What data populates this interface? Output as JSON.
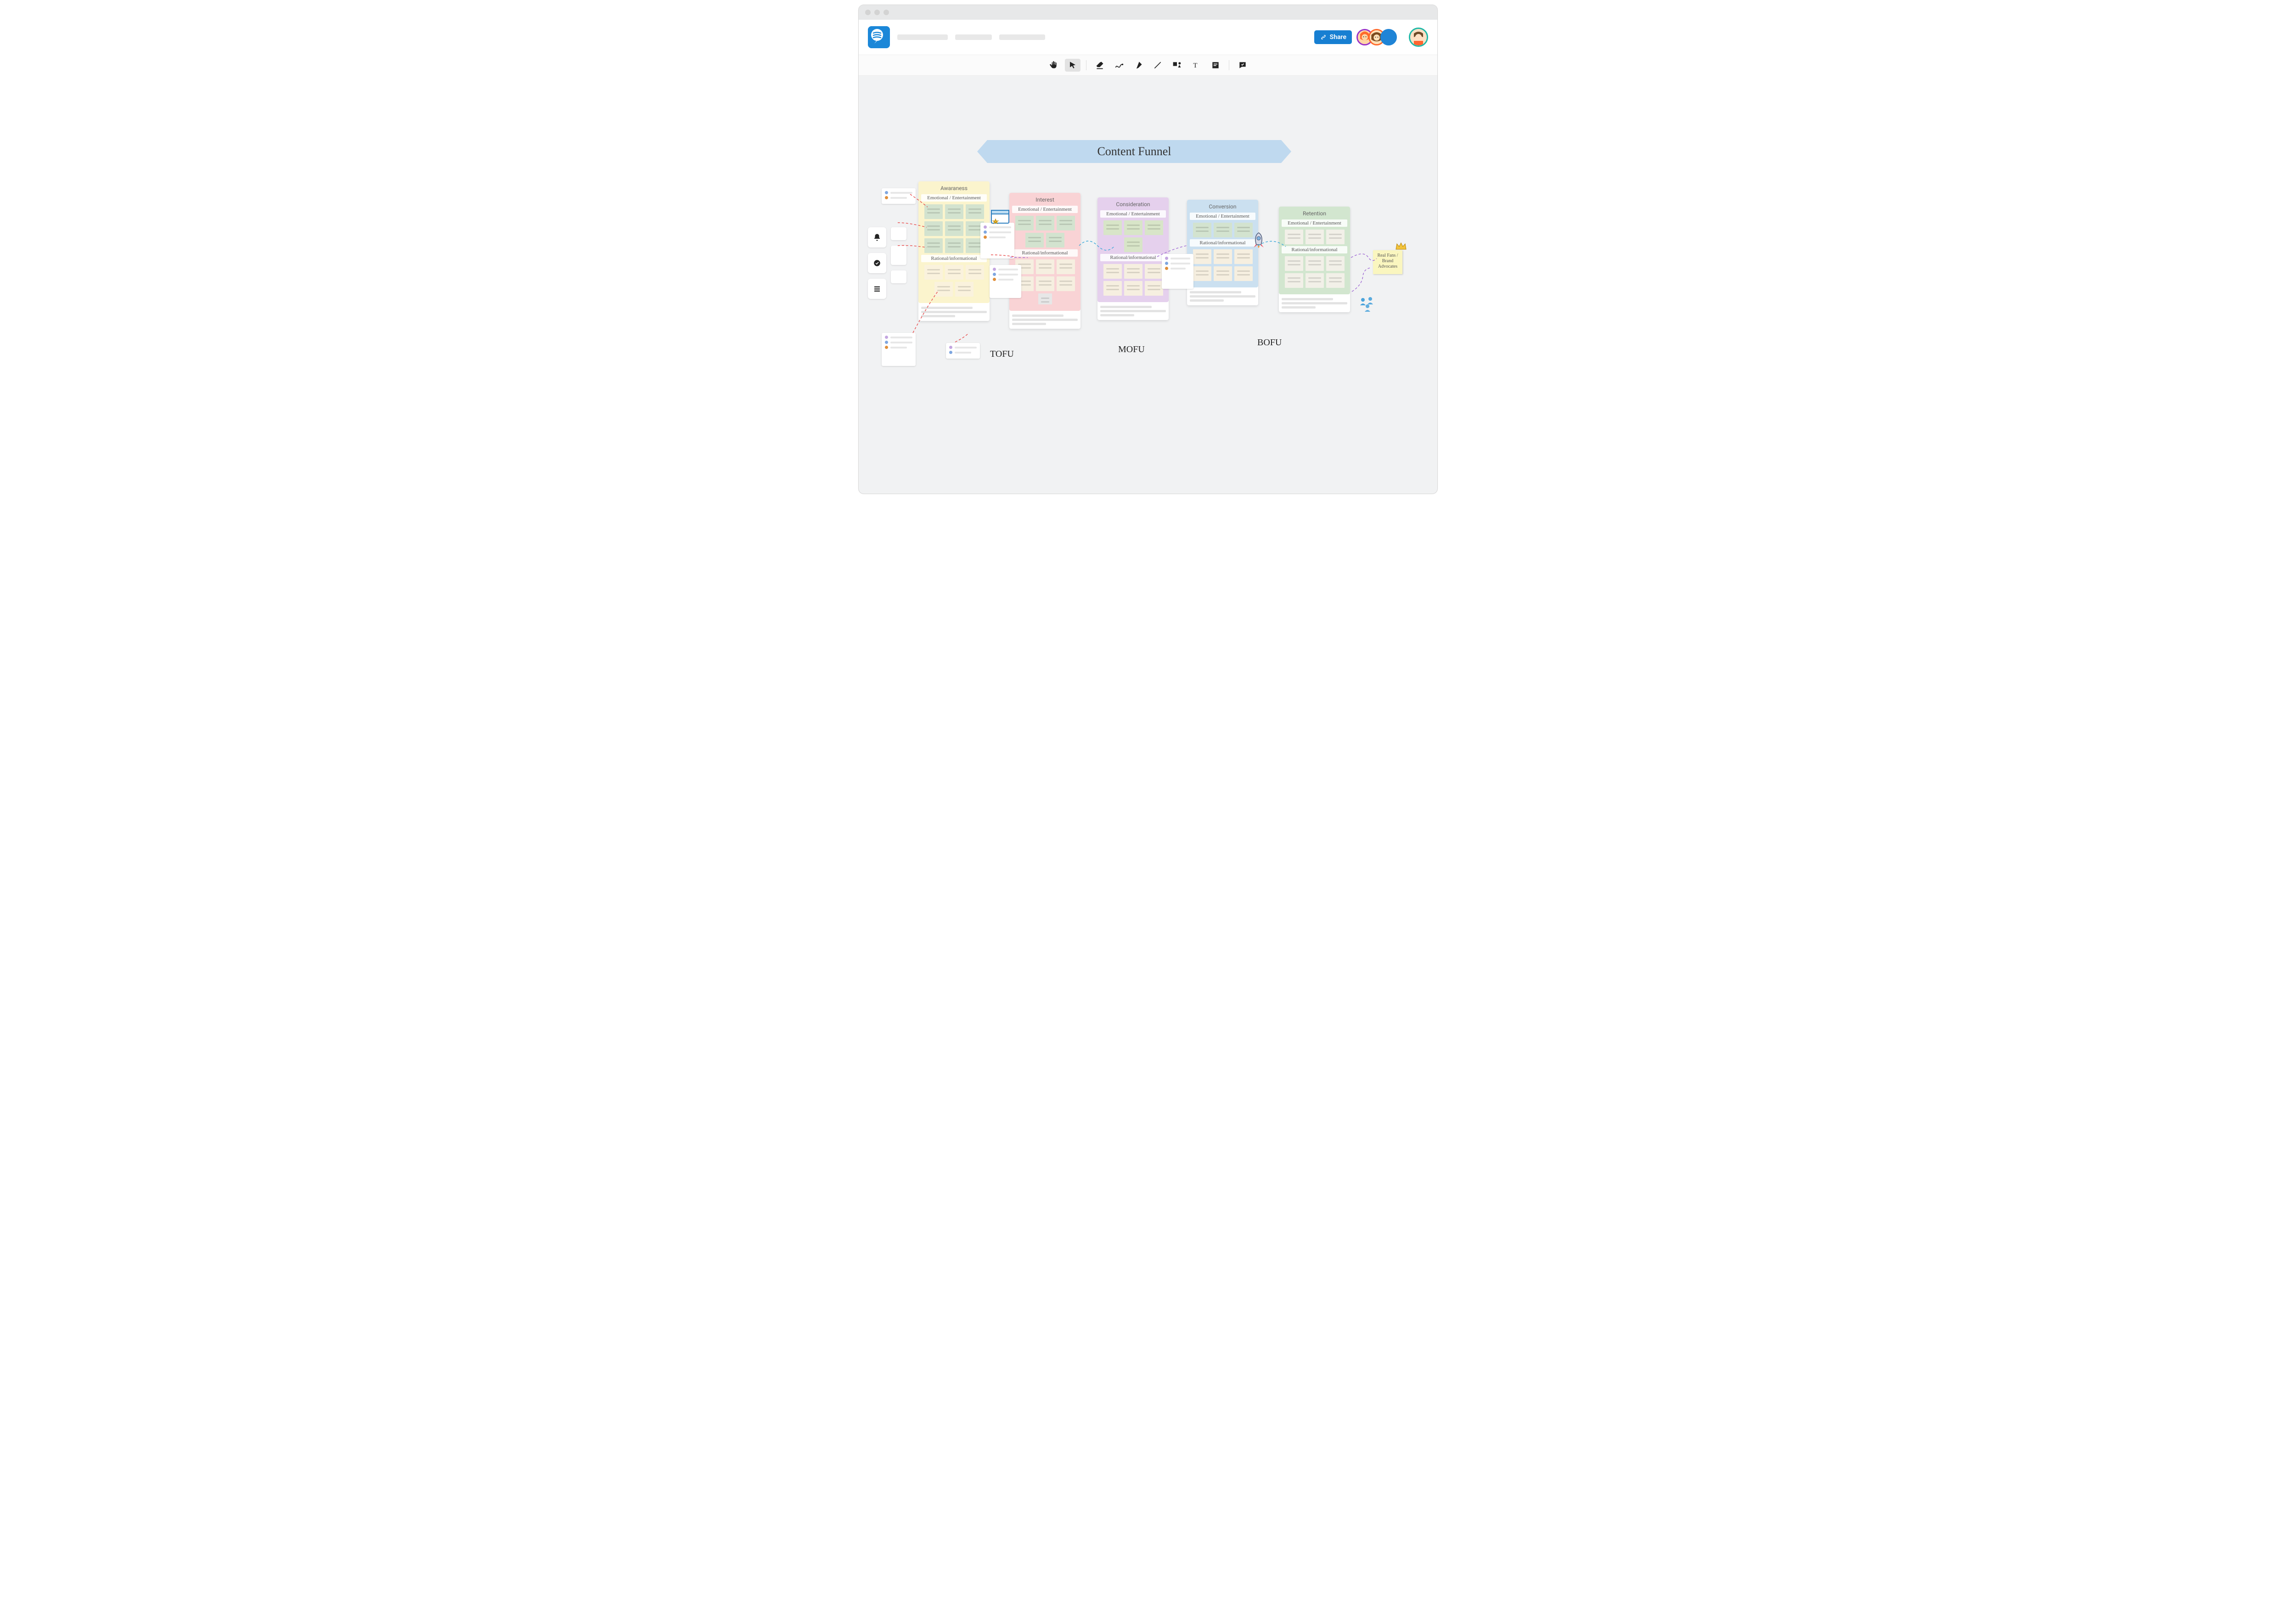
{
  "share_label": "Share",
  "banner_title": "Content Funnel",
  "section": {
    "emotional": "Emotional / Entertainment",
    "rational": "Rational/informational"
  },
  "stages": {
    "awareness": {
      "title": "Awaraness"
    },
    "interest": {
      "title": "Interest"
    },
    "consideration": {
      "title": "Consideration"
    },
    "conversion": {
      "title": "Conversion"
    },
    "retention": {
      "title": "Retention"
    }
  },
  "labels": {
    "tofu": "TOFU",
    "mofu": "MOFU",
    "bofu": "BOFU"
  },
  "end_note": "Real Fans / Brand Advocates",
  "colors": {
    "blue": "#1f84d6",
    "yellow": "#fbf4cd",
    "pink": "#f9d3d5",
    "purple": "#e5d0ed",
    "blueCard": "#cbe0f0",
    "green": "#d2e6cf"
  }
}
